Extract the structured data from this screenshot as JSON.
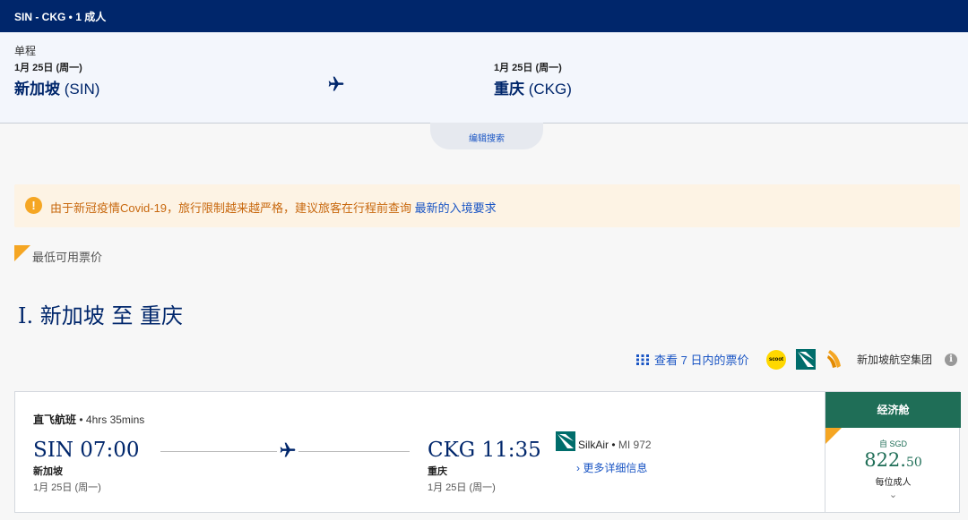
{
  "topbar": {
    "summary": "SIN - CKG  •  1 成人"
  },
  "trip": {
    "type": "单程",
    "origin": {
      "date": "1月 25日 (周一)",
      "city": "新加坡",
      "code": "(SIN)"
    },
    "destination": {
      "date": "1月 25日 (周一)",
      "city": "重庆",
      "code": "(CKG)"
    },
    "edit_label": "编辑搜索"
  },
  "alert": {
    "icon": "!",
    "text": "由于新冠疫情Covid-19，旅行限制越来越严格，建议旅客在行程前查询 ",
    "link": "最新的入境要求"
  },
  "lowest_fare_label": "最低可用票价",
  "section": {
    "title": "I. 新加坡 至 重庆"
  },
  "tools": {
    "calendar_label": "查看 7 日内的票价",
    "scoot_logo_text": "scoot",
    "group_label": "新加坡航空集团",
    "info_icon": "i"
  },
  "flight": {
    "type": "直飞航班",
    "duration": "4hrs 35mins",
    "depart": {
      "time": "SIN 07:00",
      "city": "新加坡",
      "date": "1月 25日 (周一)"
    },
    "arrive": {
      "time": "CKG 11:35",
      "city": "重庆",
      "date": "1月 25日 (周一)"
    },
    "carrier": "SilkAir",
    "flight_number": "MI 972",
    "details_label": "› 更多详细信息",
    "fare": {
      "class": "经济舱",
      "from": "自 SGD",
      "price_main": "822.",
      "price_cents": "50",
      "per": "每位成人",
      "chevron": "⌄"
    }
  },
  "colors": {
    "brand_navy": "#00266b",
    "fare_green": "#1f6e57",
    "accent_orange": "#f5a623",
    "link_blue": "#1a55c4"
  }
}
